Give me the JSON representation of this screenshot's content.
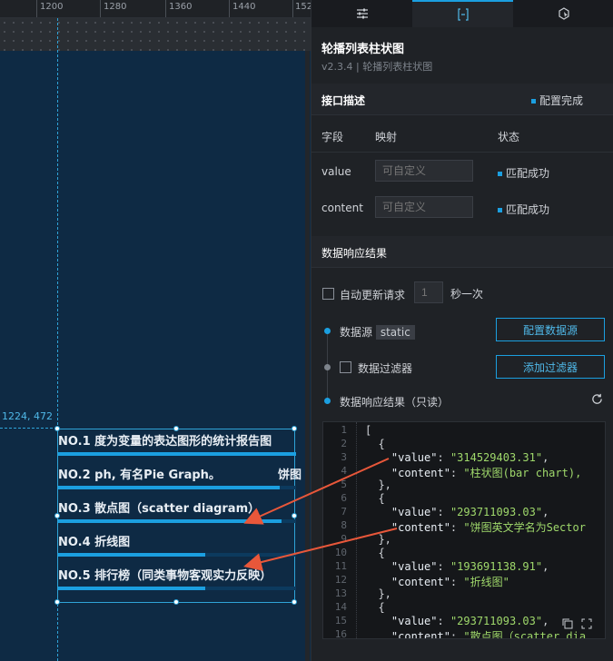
{
  "ruler": {
    "labels": [
      "1200",
      "1280",
      "1360",
      "1440",
      "152"
    ]
  },
  "canvas": {
    "coord_label": "1224, 472",
    "rows": [
      {
        "text": "NO.1  度为变量的表达图形的统计报告图",
        "progress": 1.0
      },
      {
        "text": "NO.2  ph, 有名Pie Graph。",
        "overflow": "饼图",
        "progress": 0.93
      },
      {
        "text": "NO.3  散点图（scatter diagram）",
        "progress": 0.94
      },
      {
        "text": "NO.4  折线图",
        "progress": 0.62
      },
      {
        "text": "NO.5  排行榜（同类事物客观实力反映）",
        "progress": 0.62
      }
    ]
  },
  "panel": {
    "tabs": [
      "settings",
      "data",
      "interaction"
    ],
    "title": "轮播列表柱状图",
    "subtitle": "v2.3.4 | 轮播列表柱状图",
    "interface": {
      "heading": "接口描述",
      "status": "配置完成",
      "col_field": "字段",
      "col_map": "映射",
      "col_status": "状态",
      "fields": [
        {
          "name": "value",
          "placeholder": "可自定义",
          "status": "匹配成功"
        },
        {
          "name": "content",
          "placeholder": "可自定义",
          "status": "匹配成功"
        }
      ]
    },
    "response": {
      "heading": "数据响应结果",
      "auto_update": "自动更新请求",
      "interval_value": "1",
      "interval_unit": "秒一次",
      "datasource_label": "数据源",
      "datasource_tag": "static",
      "config_btn": "配置数据源",
      "filter_label": "数据过滤器",
      "filter_btn": "添加过滤器",
      "result_label": "数据响应结果（只读）"
    },
    "code_lines": [
      {
        "n": "1",
        "t": "["
      },
      {
        "n": "2",
        "t": "  {"
      },
      {
        "n": "3",
        "k": "    \"value\"",
        "v": "\"314529403.31\"",
        "e": ","
      },
      {
        "n": "4",
        "k": "    \"content\"",
        "v": "\"柱状图(bar chart),",
        "e": ""
      },
      {
        "n": "5",
        "t": "  },"
      },
      {
        "n": "6",
        "t": "  {"
      },
      {
        "n": "7",
        "k": "    \"value\"",
        "v": "\"293711093.03\"",
        "e": ","
      },
      {
        "n": "8",
        "k": "    \"content\"",
        "v": "\"饼图英文学名为Sector",
        "e": ""
      },
      {
        "n": "9",
        "t": "  },"
      },
      {
        "n": "10",
        "t": "  {"
      },
      {
        "n": "11",
        "k": "    \"value\"",
        "v": "\"193691138.91\"",
        "e": ","
      },
      {
        "n": "12",
        "k": "    \"content\"",
        "v": "\"折线图\"",
        "e": ""
      },
      {
        "n": "13",
        "t": "  },"
      },
      {
        "n": "14",
        "t": "  {"
      },
      {
        "n": "15",
        "k": "    \"value\"",
        "v": "\"293711093.03\"",
        "e": ","
      },
      {
        "n": "16",
        "k": "    \"content\"",
        "v": "\"散点图（scatter dia",
        "e": ""
      }
    ]
  },
  "colors": {
    "accent": "#1b9fe0",
    "arrow": "#e8573a",
    "string": "#9fd86b"
  },
  "icons": [
    "sliders-icon",
    "bracket-data-icon",
    "interaction-icon",
    "refresh-icon",
    "copy-icon",
    "expand-icon"
  ]
}
